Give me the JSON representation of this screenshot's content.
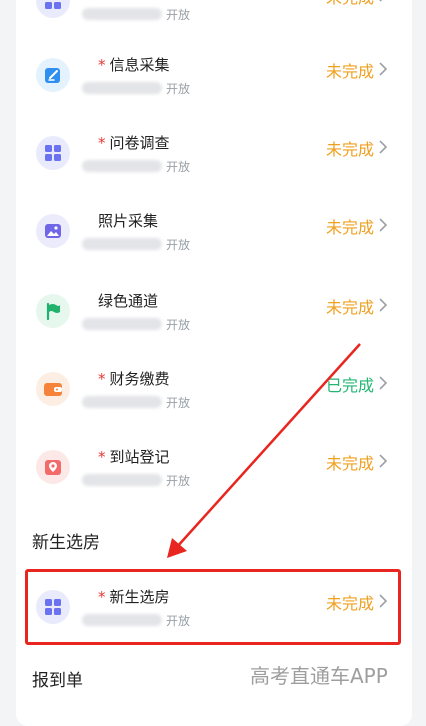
{
  "colors": {
    "incomplete": "#f0a020",
    "complete": "#22b573",
    "required_mark": "#e53935",
    "annotation": "#e8261f"
  },
  "tasks": [
    {
      "title": "",
      "required": false,
      "sub": "开放",
      "status": "未完成",
      "status_key": "incomplete",
      "icon": "grid-icon"
    },
    {
      "title": "信息采集",
      "required": true,
      "sub": "开放",
      "status": "未完成",
      "status_key": "incomplete",
      "icon": "edit-form-icon"
    },
    {
      "title": "问卷调查",
      "required": true,
      "sub": "开放",
      "status": "未完成",
      "status_key": "incomplete",
      "icon": "grid-icon"
    },
    {
      "title": "照片采集",
      "required": false,
      "sub": "开放",
      "status": "未完成",
      "status_key": "incomplete",
      "icon": "photo-icon"
    },
    {
      "title": "绿色通道",
      "required": false,
      "sub": "开放",
      "status": "未完成",
      "status_key": "incomplete",
      "icon": "flag-icon"
    },
    {
      "title": "财务缴费",
      "required": true,
      "sub": "开放",
      "status": "已完成",
      "status_key": "complete",
      "icon": "wallet-icon"
    },
    {
      "title": "到站登记",
      "required": true,
      "sub": "开放",
      "status": "未完成",
      "status_key": "incomplete",
      "icon": "location-pin-icon"
    }
  ],
  "section_room": {
    "heading": "新生选房",
    "item": {
      "title": "新生选房",
      "required": true,
      "sub": "开放",
      "status": "未完成",
      "status_key": "incomplete",
      "icon": "grid-icon"
    }
  },
  "section_report": {
    "heading": "报到单"
  },
  "required_mark": "*",
  "watermark": "高考直通车APP"
}
